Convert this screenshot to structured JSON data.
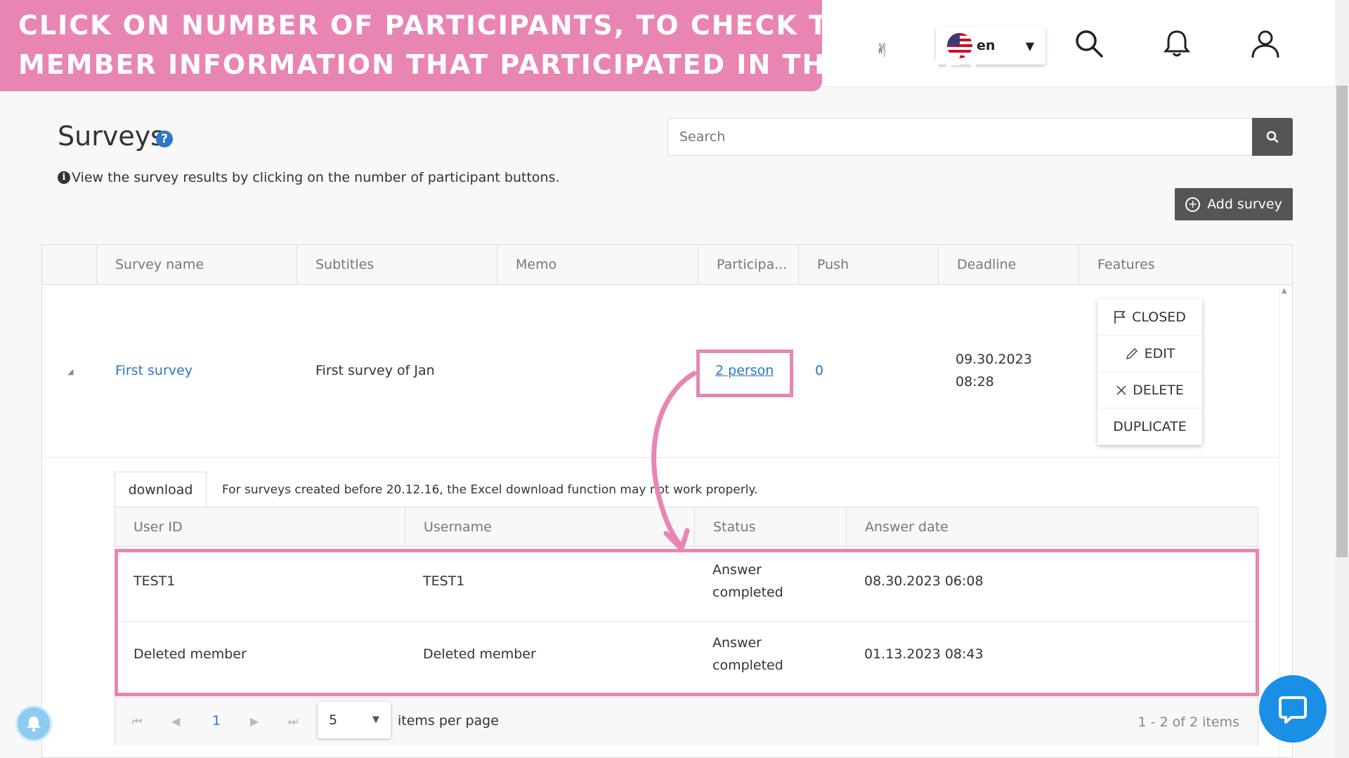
{
  "banner": {
    "line1": "CLICK ON NUMBER OF PARTICIPANTS, TO CHECK THE",
    "line2": "MEMBER INFORMATION THAT PARTICIPATED IN THE SURVEY"
  },
  "topbar": {
    "language": "en",
    "icons": [
      "hand-icon",
      "search-icon",
      "bell-icon",
      "user-icon"
    ]
  },
  "page": {
    "title": "Surveys",
    "help_glyph": "?",
    "info_glyph": "i",
    "info_text": "View the survey results by clicking on the number of participant buttons.",
    "search_placeholder": "Search",
    "add_button": "Add survey"
  },
  "table": {
    "columns": [
      "Survey name",
      "Subtitles",
      "Memo",
      "Participa...",
      "Push",
      "Deadline",
      "Features"
    ],
    "row": {
      "survey_name": "First survey",
      "subtitle": "First survey of Jan",
      "memo": "",
      "participants": "2 person",
      "push": "0",
      "deadline_date": "09.30.2023",
      "deadline_time": "08:28"
    },
    "features": {
      "closed": "CLOSED",
      "edit": "EDIT",
      "delete": "DELETE",
      "duplicate": "DUPLICATE"
    }
  },
  "detail": {
    "download_tab": "download",
    "note": "For surveys created before 20.12.16, the Excel download function may not work properly.",
    "columns": [
      "User ID",
      "Username",
      "Status",
      "Answer date"
    ],
    "rows": [
      {
        "user_id": "TEST1",
        "username": "TEST1",
        "status_line1": "Answer",
        "status_line2": "completed",
        "answer_date": "08.30.2023 06:08"
      },
      {
        "user_id": "Deleted member",
        "username": "Deleted member",
        "status_line1": "Answer",
        "status_line2": "completed",
        "answer_date": "01.13.2023 08:43"
      }
    ],
    "pager": {
      "current_page": "1",
      "per_page": "5",
      "items_per_page_label": "items per page",
      "info": "1 - 2 of 2 items"
    }
  },
  "colors": {
    "highlight": "#e885b3",
    "link": "#2c78c4",
    "dark_button": "#555555",
    "chat": "#1a8fe6"
  }
}
